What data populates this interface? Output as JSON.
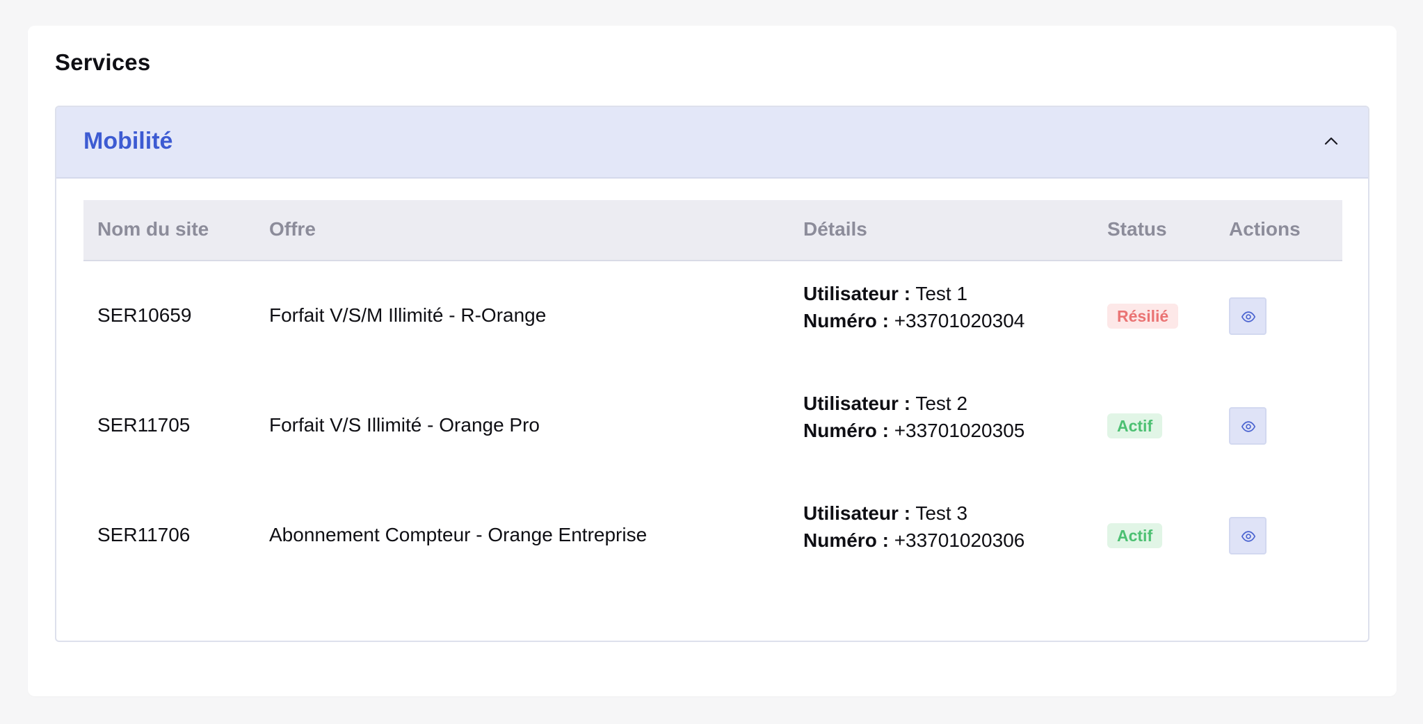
{
  "section_title": "Services",
  "accordion": {
    "title": "Mobilité",
    "expanded": true,
    "toggle_icon": "chevron-up-icon"
  },
  "table": {
    "headers": [
      "Nom du site",
      "Offre",
      "Détails",
      "Status",
      "Actions"
    ],
    "detail_labels": {
      "user": "Utilisateur :",
      "number": "Numéro :"
    },
    "rows": [
      {
        "site": "SER10659",
        "offer": "Forfait V/S/M Illimité - R-Orange",
        "user": "Test 1",
        "number": "+33701020304",
        "status": "Résilié",
        "action_icon": "eye-icon"
      },
      {
        "site": "SER11705",
        "offer": "Forfait V/S Illimité - Orange Pro",
        "user": "Test 2",
        "number": "+33701020305",
        "status": "Actif",
        "action_icon": "eye-icon"
      },
      {
        "site": "SER11706",
        "offer": "Abonnement Compteur - Orange Entreprise",
        "user": "Test 3",
        "number": "+33701020306",
        "status": "Actif",
        "action_icon": "eye-icon"
      }
    ]
  },
  "colors": {
    "accent": "#3d5bd2",
    "header_bg": "#e3e7f8",
    "status_resilie": "#ea7373",
    "status_actif": "#4cc072"
  }
}
